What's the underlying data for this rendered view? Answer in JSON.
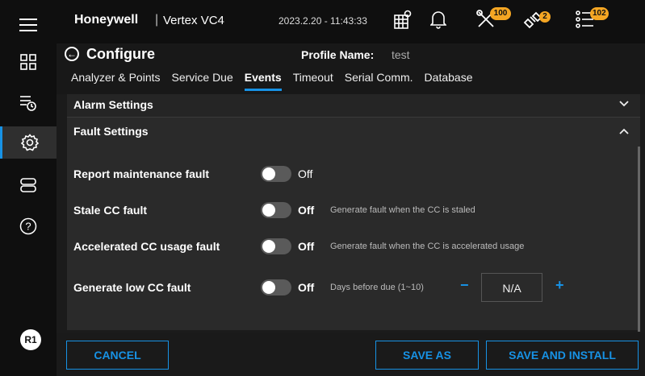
{
  "header": {
    "brand": "Honeywell",
    "separator": "|",
    "device": "Vertex VC4",
    "datetime": "2023.2.20 - 11:43:33",
    "tools_badge": "100",
    "plugin_badge": "2",
    "list_badge": "102"
  },
  "sidebar": {
    "user_initials": "R1",
    "items": [
      "menu",
      "dashboard",
      "history",
      "settings",
      "storage",
      "help"
    ]
  },
  "page": {
    "title": "Configure",
    "profile_label": "Profile Name:",
    "profile_value": "test"
  },
  "tabs": [
    "Analyzer & Points",
    "Service Due",
    "Events",
    "Timeout",
    "Serial Comm.",
    "Database"
  ],
  "active_tab": "Events",
  "sections": {
    "alarm": "Alarm Settings",
    "fault": "Fault Settings"
  },
  "faults": {
    "report_maintenance": {
      "label": "Report maintenance fault",
      "state": "Off"
    },
    "stale_cc": {
      "label": "Stale CC fault",
      "state": "Off",
      "hint": "Generate fault when the CC is staled"
    },
    "accelerated_cc": {
      "label": "Accelerated CC usage fault",
      "state": "Off",
      "hint": "Generate fault when the CC is accelerated usage"
    },
    "low_cc": {
      "label": "Generate low CC fault",
      "state": "Off",
      "hint": "Days before due (1~10)",
      "minus": "−",
      "value": "N/A",
      "plus": "+"
    }
  },
  "footer": {
    "cancel": "CANCEL",
    "save_as": "SAVE AS",
    "save_install": "SAVE AND INSTALL"
  },
  "colors": {
    "accent": "#1792e5",
    "badge": "#f5a623"
  }
}
